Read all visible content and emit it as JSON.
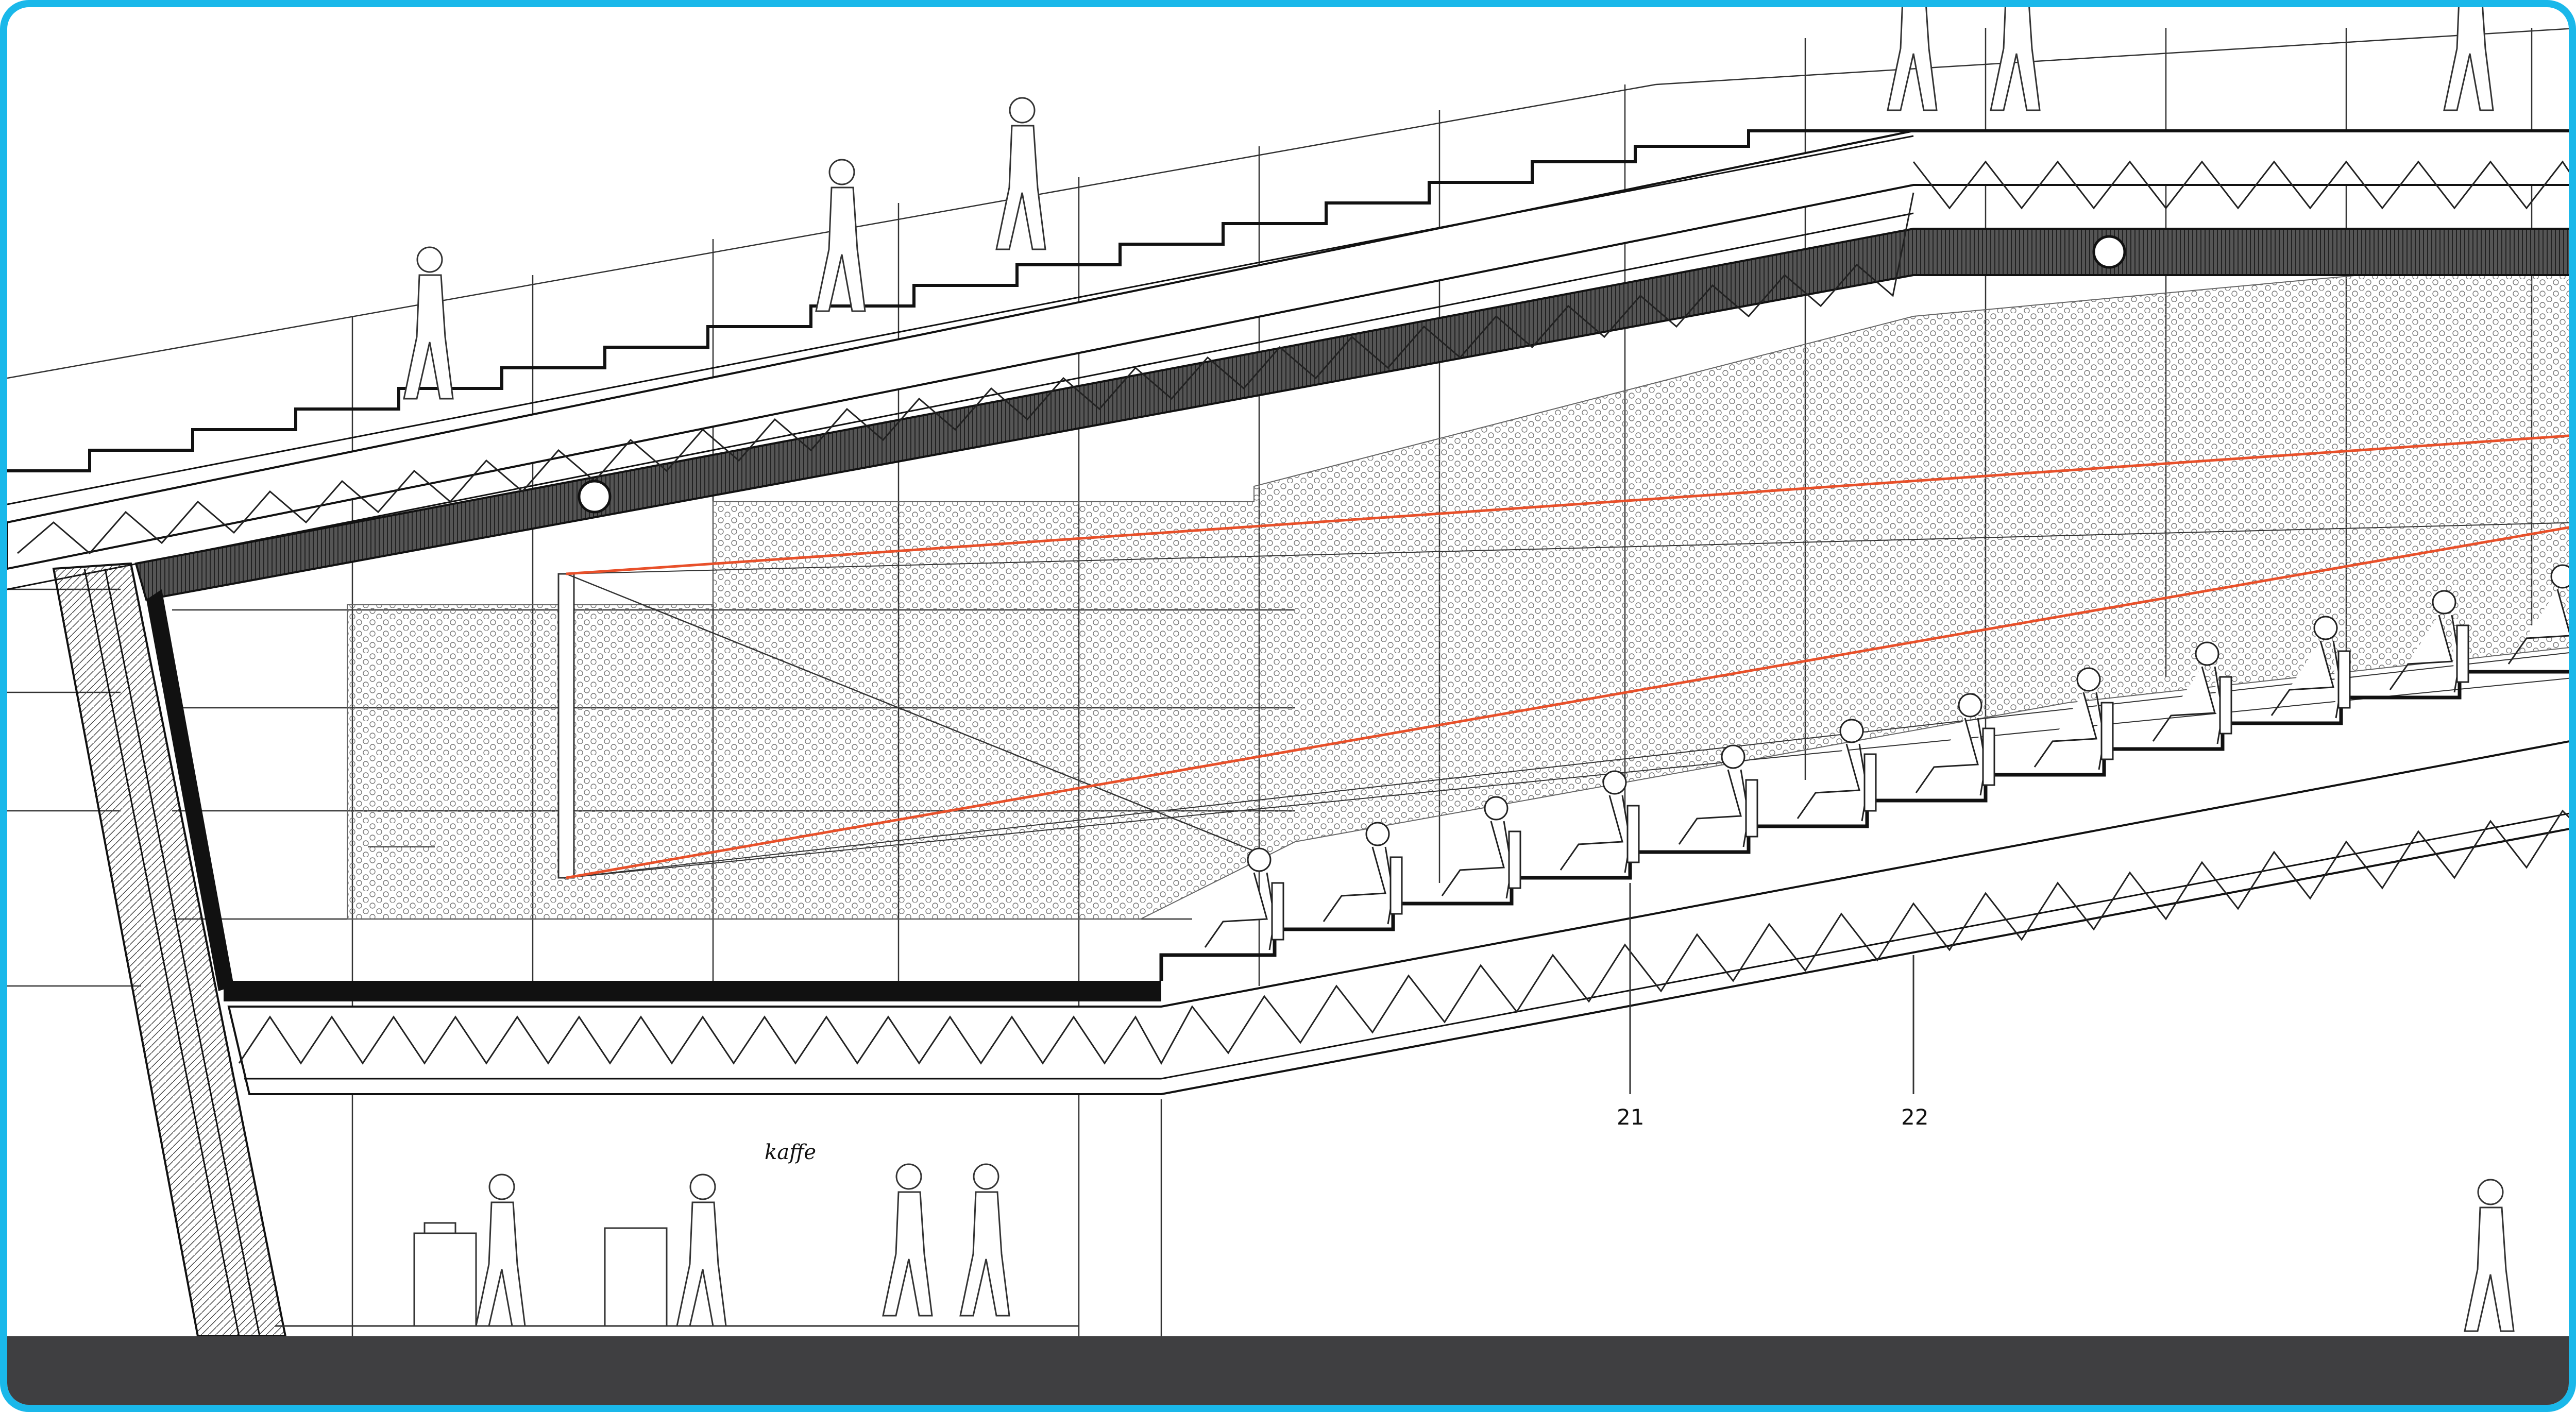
{
  "callouts": {
    "label_21": "21",
    "label_22": "22"
  },
  "cafe_sign": "kaffe",
  "colors": {
    "frame_border": "#1ab8ea",
    "sightline_accent": "#e8502a",
    "ground_band": "#3f3f41",
    "line": "#1a1a1a"
  },
  "icons": [
    "person-walking-icon",
    "person-seated-icon",
    "person-standing-icon",
    "cafe-table-icon"
  ]
}
